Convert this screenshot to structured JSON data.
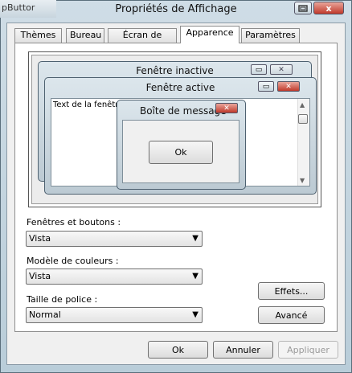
{
  "background_app_label": "pButtor",
  "window": {
    "title": "Propriétés de Affichage",
    "minimize_icon": "restore-icon",
    "close_glyph": "x"
  },
  "tabs": [
    {
      "label": "Thèmes"
    },
    {
      "label": "Bureau"
    },
    {
      "label": "Écran de veille"
    },
    {
      "label": "Apparence",
      "active": true
    },
    {
      "label": "Paramètres"
    }
  ],
  "preview": {
    "inactive_title": "Fenêtre inactive",
    "active_title": "Fenêtre active",
    "window_text": "Text de la fenêtre",
    "message_title": "Boîte de message",
    "message_ok": "Ok"
  },
  "windows_and_buttons": {
    "label": "Fenêtres et boutons :",
    "value": "Vista"
  },
  "color_scheme": {
    "label": "Modèle de couleurs :",
    "value": "Vista"
  },
  "font_size": {
    "label": "Taille de police :",
    "value": "Normal"
  },
  "buttons": {
    "effects": "Effets...",
    "advanced": "Avancé",
    "ok": "Ok",
    "cancel": "Annuler",
    "apply": "Appliquer"
  },
  "colors": {
    "close_red": "#c0392b",
    "frame": "#b9cdd9"
  }
}
